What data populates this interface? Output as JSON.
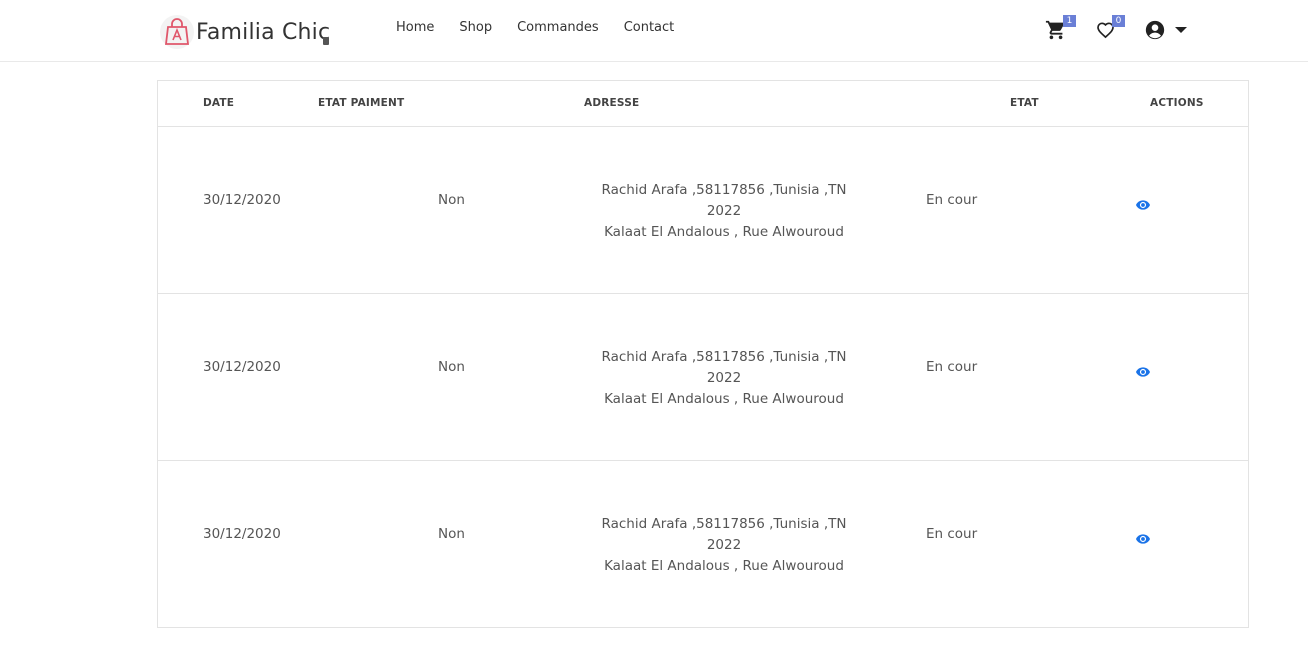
{
  "brand": {
    "name": "Familia Chic"
  },
  "nav": {
    "links": [
      "Home",
      "Shop",
      "Commandes",
      "Contact"
    ],
    "cart_count": "1",
    "wishlist_count": "0"
  },
  "table": {
    "headers": {
      "date": "DATE",
      "etat_paiment": "ETAT PAIMENT",
      "adresse": "ADRESSE",
      "etat": "ETAT",
      "actions": "ACTIONS"
    },
    "rows": [
      {
        "date": "30/12/2020",
        "paiment": "Non",
        "adresse_line1": "Rachid Arafa ,58117856 ,Tunisia ,TN 2022",
        "adresse_line2": "Kalaat El Andalous , Rue Alwouroud",
        "etat": "En cour"
      },
      {
        "date": "30/12/2020",
        "paiment": "Non",
        "adresse_line1": "Rachid Arafa ,58117856 ,Tunisia ,TN 2022",
        "adresse_line2": "Kalaat El Andalous , Rue Alwouroud",
        "etat": "En cour"
      },
      {
        "date": "30/12/2020",
        "paiment": "Non",
        "adresse_line1": "Rachid Arafa ,58117856 ,Tunisia ,TN 2022",
        "adresse_line2": "Kalaat El Andalous , Rue Alwouroud",
        "etat": "En cour"
      }
    ]
  },
  "colors": {
    "badge": "#6a7fd6",
    "eye_icon": "#1a73e8",
    "logo_accent": "#e0576b"
  },
  "icons": [
    "logo-bag-icon",
    "cart-icon",
    "heart-icon",
    "user-circle-icon",
    "caret-down-icon",
    "eye-icon"
  ]
}
